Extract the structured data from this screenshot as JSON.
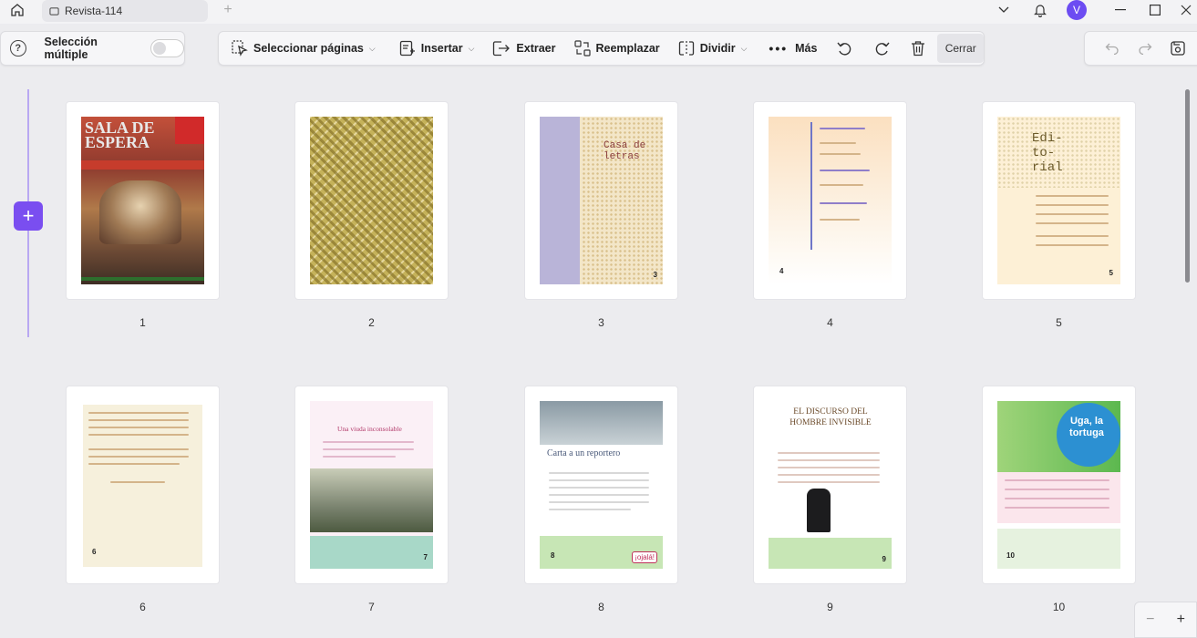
{
  "tab": {
    "title": "Revista-114"
  },
  "user": {
    "initial": "V"
  },
  "left_panel": {
    "multi_select_label": "Selección múltiple"
  },
  "toolbar": {
    "select_pages": "Seleccionar páginas",
    "insert": "Insertar",
    "extract": "Extraer",
    "replace": "Reemplazar",
    "split": "Dividir",
    "more": "Más",
    "close": "Cerrar"
  },
  "pages": [
    {
      "number": "1",
      "title": "SALA DE ESPERA"
    },
    {
      "number": "2"
    },
    {
      "number": "3",
      "title": "Casa de letras",
      "page_label": "3"
    },
    {
      "number": "4",
      "page_label": "4"
    },
    {
      "number": "5",
      "title": "Edi-to-rial",
      "page_label": "5"
    },
    {
      "number": "6",
      "page_label": "6"
    },
    {
      "number": "7",
      "title": "Una viuda inconsolable",
      "page_label": "7"
    },
    {
      "number": "8",
      "title": "Carta a un reportero",
      "page_label": "8",
      "badge": "¡ojalá!"
    },
    {
      "number": "9",
      "title": "EL DISCURSO DEL HOMBRE INVISIBLE",
      "page_label": "9"
    },
    {
      "number": "10",
      "title": "Uga, la tortuga",
      "page_label": "10"
    }
  ],
  "colors": {
    "accent": "#7a4ef0",
    "rail": "#b9a8f2"
  }
}
